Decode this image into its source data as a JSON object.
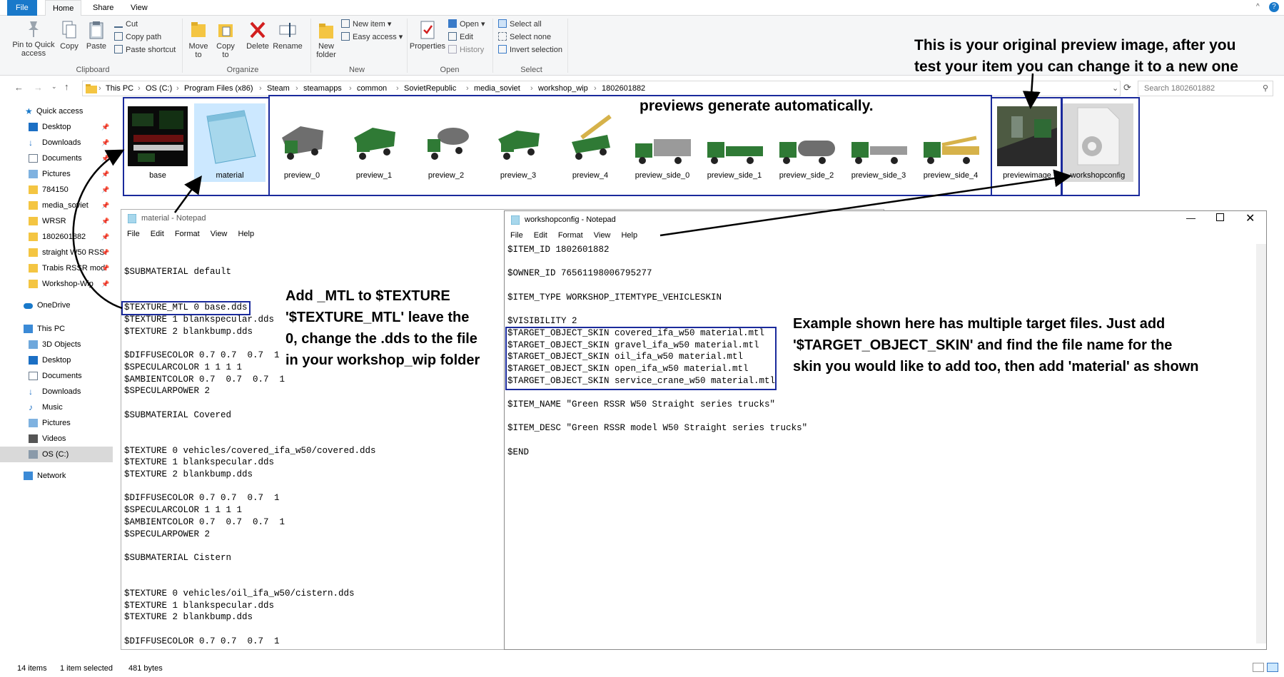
{
  "ribbon_tabs": {
    "file": "File",
    "home": "Home",
    "share": "Share",
    "view": "View"
  },
  "clipboard": {
    "pin": "Pin to Quick access",
    "copy": "Copy",
    "paste": "Paste",
    "cut": "Cut",
    "copy_path": "Copy path",
    "paste_shortcut": "Paste shortcut",
    "group": "Clipboard"
  },
  "organize": {
    "move_to": "Move to",
    "copy_to": "Copy to",
    "delete": "Delete",
    "rename": "Rename",
    "group": "Organize"
  },
  "new_group": {
    "new_folder": "New folder",
    "new_item": "New item",
    "easy_access": "Easy access",
    "group": "New"
  },
  "open_group": {
    "properties": "Properties",
    "open": "Open",
    "edit": "Edit",
    "history": "History",
    "group": "Open"
  },
  "select_group": {
    "select_all": "Select all",
    "select_none": "Select none",
    "invert": "Invert selection",
    "group": "Select"
  },
  "breadcrumb": [
    "This PC",
    "OS (C:)",
    "Program Files (x86)",
    "Steam",
    "steamapps",
    "common",
    "SovietRepublic",
    "media_soviet",
    "workshop_wip",
    "1802601882"
  ],
  "search_placeholder": "Search 1802601882",
  "nav": {
    "quick_access": "Quick access",
    "quick_items": [
      "Desktop",
      "Downloads",
      "Documents",
      "Pictures",
      "784150",
      "media_soviet",
      "WRSR",
      "1802601882",
      "straight W50 RSS",
      "Trabis RSSR mod",
      "Workshop-Wip"
    ],
    "onedrive": "OneDrive",
    "this_pc": "This PC",
    "pc_items": [
      "3D Objects",
      "Desktop",
      "Documents",
      "Downloads",
      "Music",
      "Pictures",
      "Videos",
      "OS (C:)"
    ],
    "network": "Network"
  },
  "files": [
    "base",
    "material",
    "preview_0",
    "preview_1",
    "preview_2",
    "preview_3",
    "preview_4",
    "preview_side_0",
    "preview_side_1",
    "preview_side_2",
    "preview_side_3",
    "preview_side_4",
    "previewimage",
    "workshopconfig"
  ],
  "notepad_material": {
    "title": "material - Notepad",
    "menu": [
      "File",
      "Edit",
      "Format",
      "View",
      "Help"
    ],
    "lines": [
      "",
      "",
      "$SUBMATERIAL default",
      "",
      "",
      "$TEXTURE_MTL 0 base.dds",
      "$TEXTURE 1 blankspecular.dds",
      "$TEXTURE 2 blankbump.dds",
      "",
      "$DIFFUSECOLOR 0.7 0.7  0.7  1",
      "$SPECULARCOLOR 1 1 1 1",
      "$AMBIENTCOLOR 0.7  0.7  0.7  1",
      "$SPECULARPOWER 2",
      "",
      "$SUBMATERIAL Covered",
      "",
      "",
      "$TEXTURE 0 vehicles/covered_ifa_w50/covered.dds",
      "$TEXTURE 1 blankspecular.dds",
      "$TEXTURE 2 blankbump.dds",
      "",
      "$DIFFUSECOLOR 0.7 0.7  0.7  1",
      "$SPECULARCOLOR 1 1 1 1",
      "$AMBIENTCOLOR 0.7  0.7  0.7  1",
      "$SPECULARPOWER 2",
      "",
      "$SUBMATERIAL Cistern",
      "",
      "",
      "$TEXTURE 0 vehicles/oil_ifa_w50/cistern.dds",
      "$TEXTURE 1 blankspecular.dds",
      "$TEXTURE 2 blankbump.dds",
      "",
      "$DIFFUSECOLOR 0.7 0.7  0.7  1"
    ]
  },
  "notepad_workshop": {
    "title": "workshopconfig - Notepad",
    "menu": [
      "File",
      "Edit",
      "Format",
      "View",
      "Help"
    ],
    "lines": [
      "$ITEM_ID 1802601882",
      "",
      "$OWNER_ID 76561198006795277",
      "",
      "$ITEM_TYPE WORKSHOP_ITEMTYPE_VEHICLESKIN",
      "",
      "$VISIBILITY 2",
      "$TARGET_OBJECT_SKIN covered_ifa_w50 material.mtl",
      "$TARGET_OBJECT_SKIN gravel_ifa_w50 material.mtl",
      "$TARGET_OBJECT_SKIN oil_ifa_w50 material.mtl",
      "$TARGET_OBJECT_SKIN open_ifa_w50 material.mtl",
      "$TARGET_OBJECT_SKIN service_crane_w50 material.mtl",
      "",
      "$ITEM_NAME \"Green RSSR W50 Straight series trucks\"",
      "",
      "$ITEM_DESC \"Green RSSR model W50 Straight series trucks\"",
      "",
      "$END"
    ]
  },
  "annotations": {
    "preview_original_1": "This is your original preview image, after you",
    "preview_original_2": "test your item you can change it to a new one",
    "previews_auto": "previews generate automatically.",
    "mtl_1": "Add _MTL to $TEXTURE",
    "mtl_2": "'$TEXTURE_MTL' leave the",
    "mtl_3": "0, change the .dds to the file",
    "mtl_4": "in your workshop_wip folder",
    "target_1": "Example shown here has multiple target files. Just add",
    "target_2": "'$TARGET_OBJECT_SKIN' and find the file name for the",
    "target_3": "skin you would like to add too, then add 'material' as shown"
  },
  "status": {
    "items": "14 items",
    "selected": "1 item selected",
    "size": "481 bytes"
  },
  "colors": {
    "accent": "#1979ca",
    "annotation_box": "#1a2a9c",
    "selected": "#cce8ff"
  }
}
